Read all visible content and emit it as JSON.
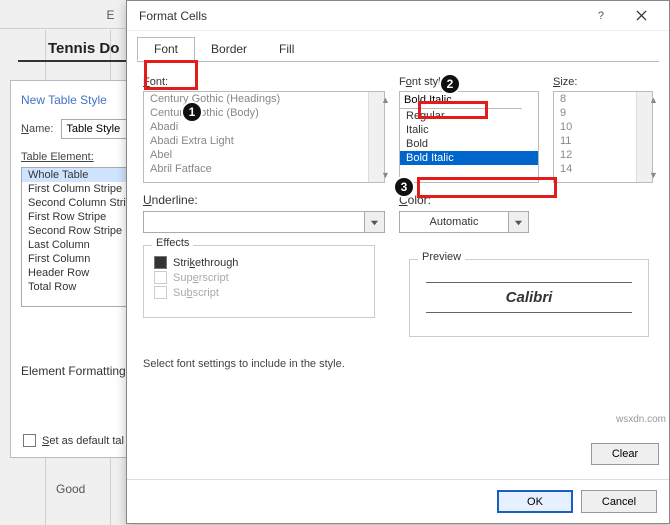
{
  "bg": {
    "col": "E",
    "title": "Tennis Do",
    "good": "Good"
  },
  "nts": {
    "heading": "New Table Style",
    "name_label": "Name:",
    "name_value": "Table Style",
    "te_label": "Table Element:",
    "elements": [
      "Whole Table",
      "First Column Stripe",
      "Second Column Stripe",
      "First Row Stripe",
      "Second Row Stripe",
      "Last Column",
      "First Column",
      "Header Row",
      "Total Row"
    ],
    "ef_label": "Element Formatting",
    "default_label": "Set as default tal"
  },
  "dlg": {
    "title": "Format Cells",
    "tabs": [
      "Font",
      "Border",
      "Fill"
    ],
    "font_label": "Font:",
    "fonts": [
      "Century Gothic (Headings)",
      "Century Gothic (Body)",
      "Abadi",
      "Abadi Extra Light",
      "Abel",
      "Abril Fatface"
    ],
    "style_label": "Font style:",
    "style_input": "Bold Italic",
    "styles": [
      "Regular",
      "Italic",
      "Bold",
      "Bold Italic"
    ],
    "size_label": "Size:",
    "sizes": [
      "8",
      "9",
      "10",
      "11",
      "12",
      "14"
    ],
    "underline_label": "Underline:",
    "underline_value": "",
    "color_label": "Color:",
    "color_value": "Automatic",
    "effects_label": "Effects",
    "eff": {
      "strike": "Strikethrough",
      "sup": "Superscript",
      "sub": "Subscript"
    },
    "preview_label": "Preview",
    "preview_text": "Calibri",
    "note": "Select font settings to include in the style.",
    "clear": "Clear",
    "ok": "OK",
    "cancel": "Cancel"
  },
  "watermark": "wsxdn.com"
}
